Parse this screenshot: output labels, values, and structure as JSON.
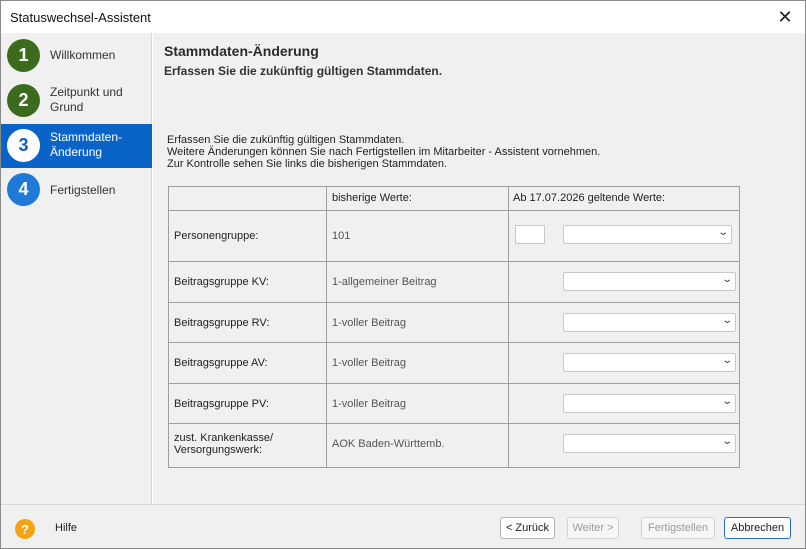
{
  "window": {
    "title": "Statuswechsel-Assistent"
  },
  "steps": [
    {
      "number": "1",
      "label": "Willkommen",
      "state": "done"
    },
    {
      "number": "2",
      "label": "Zeitpunkt und Grund",
      "state": "done"
    },
    {
      "number": "3",
      "label": "Stammdaten-Änderung",
      "state": "active"
    },
    {
      "number": "4",
      "label": "Fertigstellen",
      "state": "pending"
    }
  ],
  "header": {
    "title": "Stammdaten-Änderung",
    "subtitle": "Erfassen Sie die zukünftig gültigen Stammdaten."
  },
  "intro": [
    "Erfassen Sie die zukünftig gültigen Stammdaten.",
    "Weitere Änderungen können Sie nach Fertigstellen im Mitarbeiter - Assistent vornehmen.",
    "Zur Kontrolle sehen Sie links die bisherigen Stammdaten."
  ],
  "table": {
    "col_previous": "bisherige Werte:",
    "col_new": "Ab 17.07.2026 geltende Werte:",
    "rows": [
      {
        "label": "Personengruppe:",
        "previous": "101",
        "new_value": "",
        "code": ""
      },
      {
        "label": "Beitragsgruppe KV:",
        "previous": "1-allgemeiner Beitrag",
        "new_value": ""
      },
      {
        "label": "Beitragsgruppe RV:",
        "previous": "1-voller Beitrag",
        "new_value": ""
      },
      {
        "label": "Beitragsgruppe AV:",
        "previous": "1-voller Beitrag",
        "new_value": ""
      },
      {
        "label": "Beitragsgruppe PV:",
        "previous": "1-voller Beitrag",
        "new_value": ""
      },
      {
        "label_line1": "zust. Krankenkasse/",
        "label_line2": "Versorgungswerk:",
        "previous": "AOK Baden-Württemb.",
        "new_value": ""
      }
    ]
  },
  "footer": {
    "help": "Hilfe",
    "back": "< Zurück",
    "next": "Weiter >",
    "finish": "Fertigstellen",
    "cancel": "Abbrechen"
  }
}
